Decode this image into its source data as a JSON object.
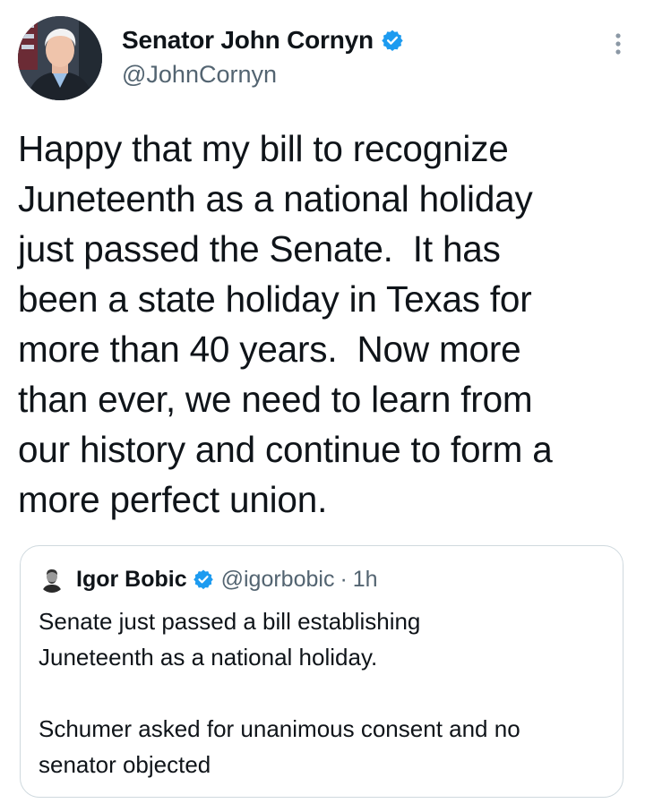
{
  "tweet": {
    "display_name": "Senator John Cornyn",
    "handle": "@JohnCornyn",
    "text": "Happy that my bill to recognize\nJuneteenth as a national holiday\njust passed the Senate.  It has\nbeen a state holiday in Texas for\nmore than 40 years.  Now more\nthan ever, we need to learn from\nour history and continue to form a\nmore perfect union.",
    "verified_color": "#1d9bf0",
    "more_icon": "more-vertical-icon"
  },
  "quote": {
    "display_name": "Igor Bobic",
    "handle": "@igorbobic",
    "separator": "·",
    "time": "1h",
    "text": "Senate just passed a bill establishing\nJuneteenth as a national holiday.\n\nSchumer asked for unanimous consent and no\nsenator objected"
  }
}
